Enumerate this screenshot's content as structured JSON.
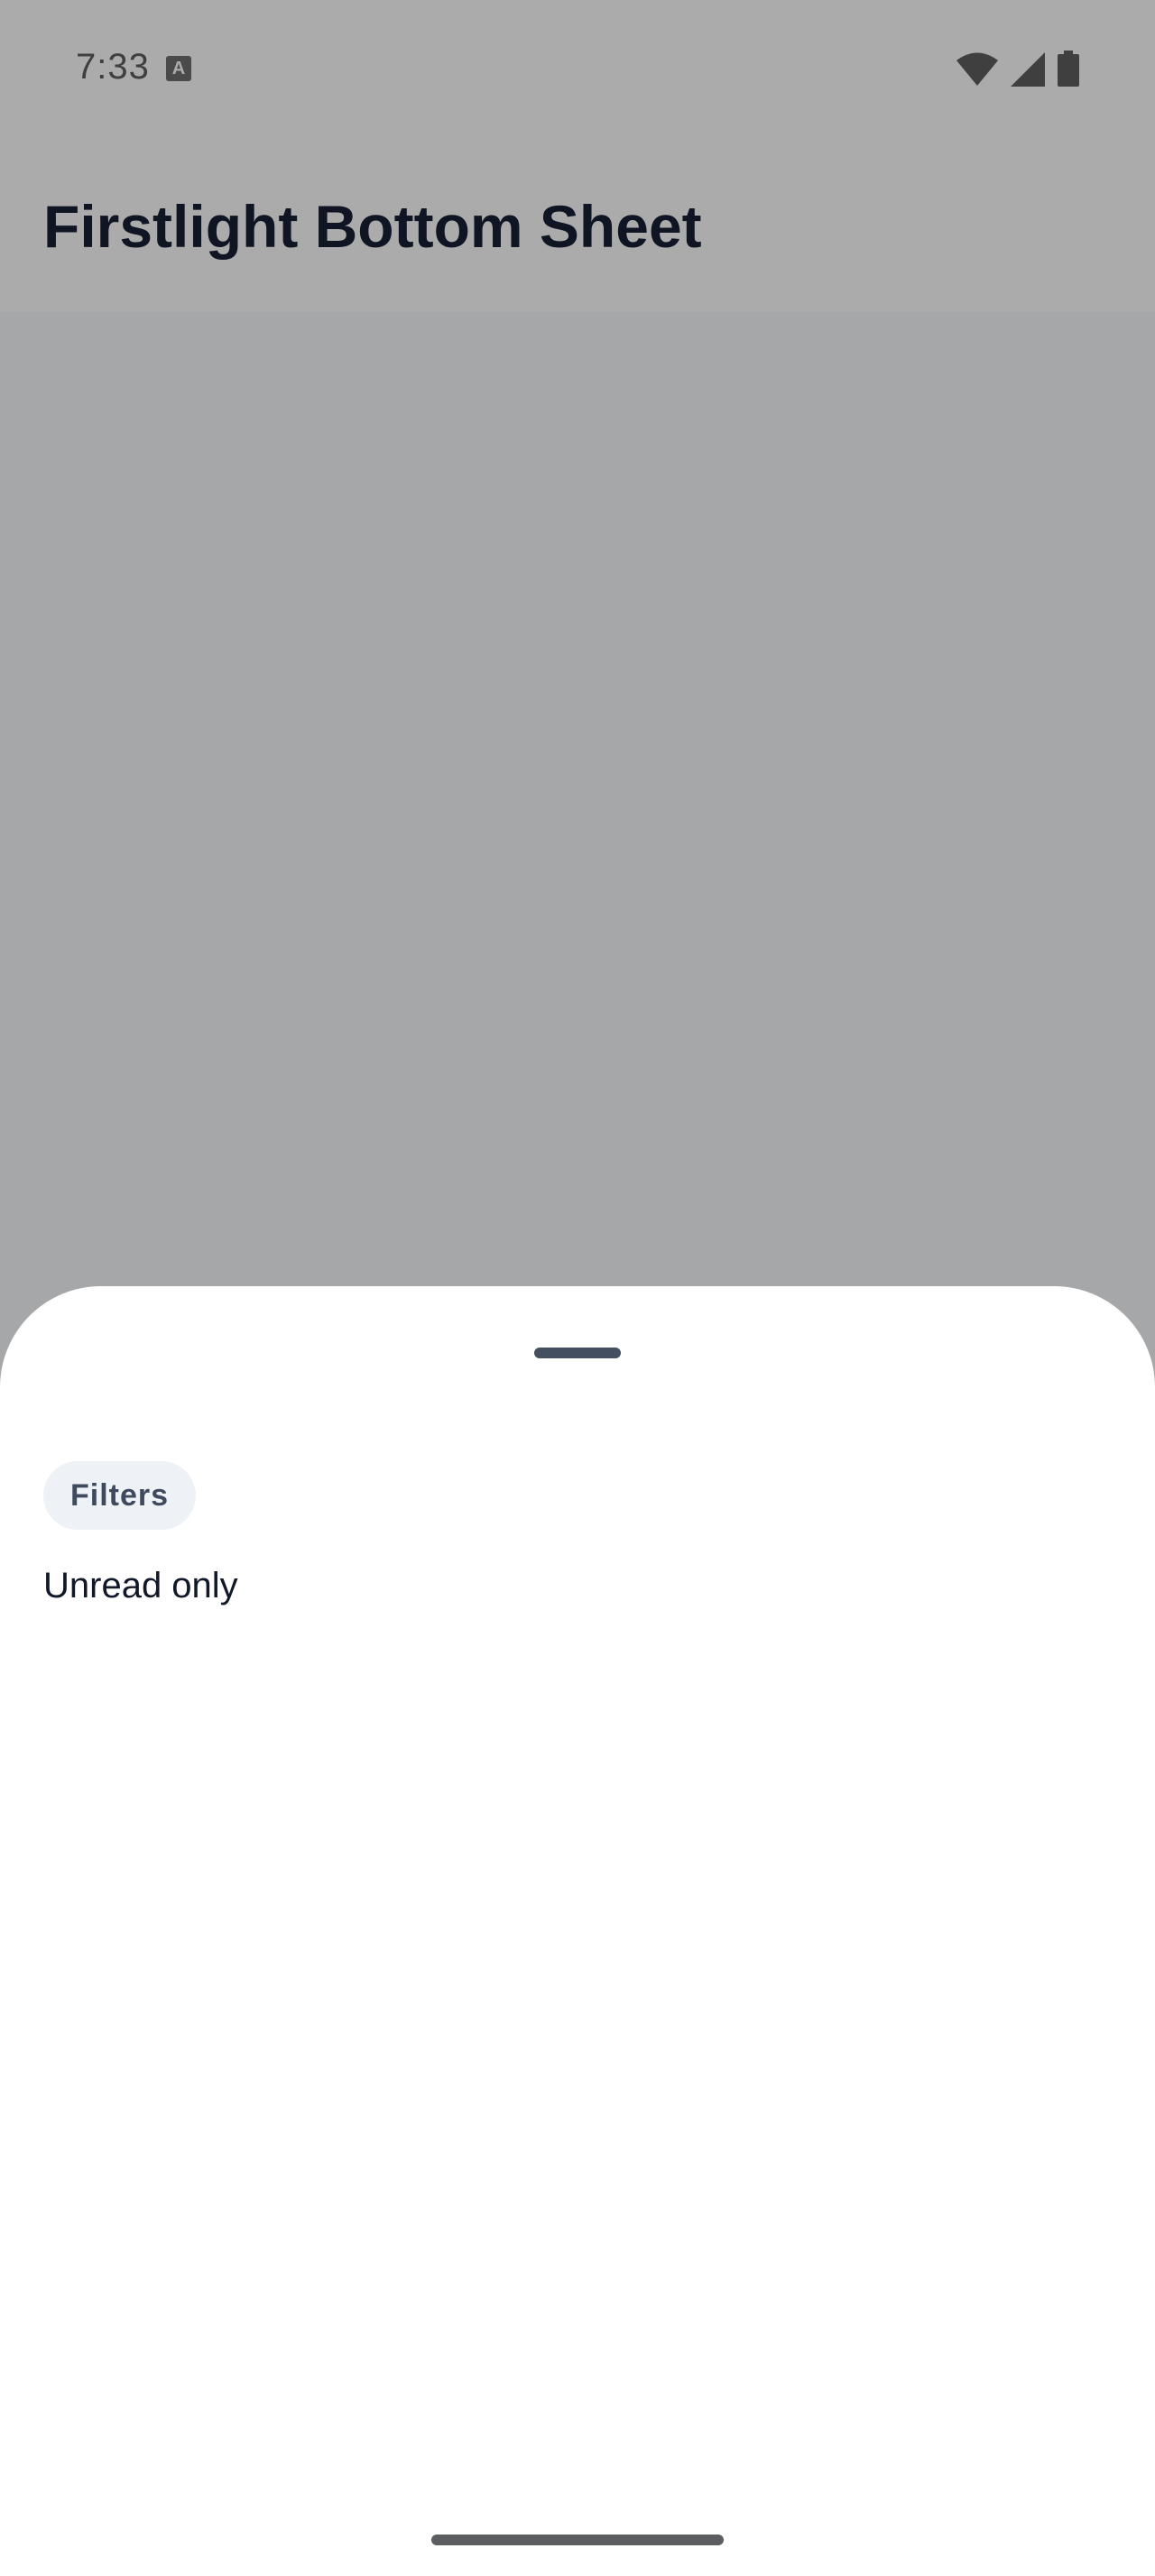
{
  "status_bar": {
    "time": "7:33",
    "notification_icon": "a-icon",
    "notification_glyph": "A",
    "icons": [
      "wifi-icon",
      "signal-icon",
      "battery-icon"
    ]
  },
  "app_bar": {
    "title": "Firstlight Bottom Sheet"
  },
  "bottom_sheet": {
    "chip_label": "Filters",
    "option_label": "Unread only"
  },
  "colors": {
    "app_bar_bg": "#ababab",
    "scrim": "#a6a7a9",
    "sheet_bg": "#ffffff",
    "title_text": "#0f1522",
    "chip_bg": "#eef2f7",
    "chip_text": "#3f4a5e",
    "handle": "#454f62"
  }
}
